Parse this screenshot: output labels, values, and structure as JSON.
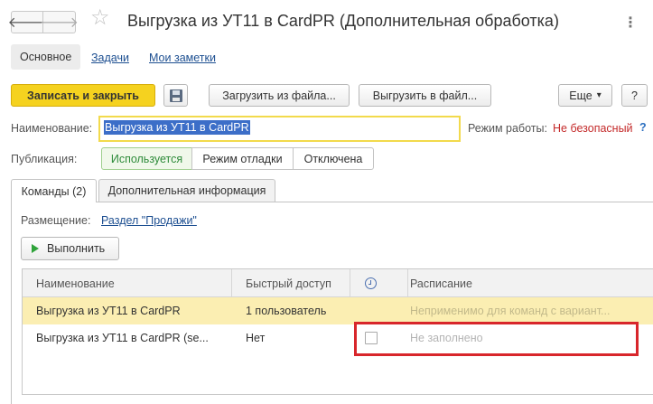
{
  "window": {
    "title": "Выгрузка из УТ11 в CardPR (Дополнительная обработка)",
    "back_icon": "arrow-left-icon",
    "forward_icon": "arrow-right-icon",
    "favorite_icon": "star-icon",
    "more_icon": "vertical-dots-icon",
    "more_glyph": "⋮"
  },
  "top_tabs": [
    {
      "label": "Основное",
      "active": true
    },
    {
      "label": "Задачи",
      "active": false
    },
    {
      "label": "Мои заметки",
      "active": false
    }
  ],
  "toolbar": {
    "save_close_label": "Записать и закрыть",
    "load_label": "Загрузить из файла...",
    "unload_label": "Выгрузить в файл...",
    "more_label": "Еще",
    "more_arrow": "▾",
    "help_label": "?",
    "accent_color": "#f5d21f"
  },
  "form": {
    "name_label": "Наименование:",
    "name_value": "Выгрузка из УТ11 в CardPR",
    "mode_label": "Режим работы:",
    "mode_value": "Не безопасный",
    "mode_help": "?",
    "publication_label": "Публикация:",
    "publication_options": [
      "Используется",
      "Режим отладки",
      "Отключена"
    ],
    "publication_selected": "Используется"
  },
  "inner_tabs": [
    {
      "label": "Команды (2)",
      "active": true
    },
    {
      "label": "Дополнительная информация",
      "active": false
    }
  ],
  "commands": {
    "placement_label": "Размещение:",
    "placement_value": "Раздел \"Продажи\"",
    "execute_label": "Выполнить",
    "columns": [
      "Наименование",
      "Быстрый доступ",
      "",
      "Расписание"
    ],
    "rows": [
      {
        "name": "Выгрузка из УТ11 в CardPR",
        "quick_access": "1 пользователь",
        "checked": null,
        "schedule": "Неприменимо для команд с вариант...",
        "selected": true
      },
      {
        "name": "Выгрузка из УТ11 в CardPR (se...",
        "quick_access": "Нет",
        "checked": false,
        "schedule": "Не заполнено",
        "selected": false
      }
    ]
  }
}
